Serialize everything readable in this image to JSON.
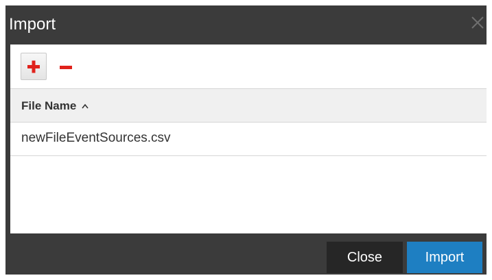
{
  "dialog": {
    "title": "Import"
  },
  "toolbar": {
    "add_icon": "plus-icon",
    "remove_icon": "minus-icon",
    "icon_color": "#e0221c"
  },
  "table": {
    "columns": [
      {
        "label": "File Name",
        "sort": "ascending"
      }
    ],
    "rows": [
      {
        "file_name": "newFileEventSources.csv"
      }
    ]
  },
  "footer": {
    "close_label": "Close",
    "import_label": "Import"
  },
  "colors": {
    "dialog_bg": "#3b3b3b",
    "primary_button": "#1e7fc2",
    "secondary_button": "#262626"
  }
}
